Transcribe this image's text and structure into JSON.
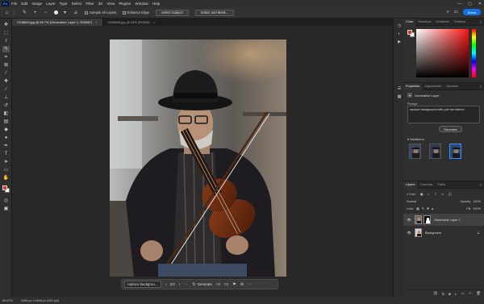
{
  "menu": [
    "File",
    "Edit",
    "Image",
    "Layer",
    "Type",
    "Select",
    "Filter",
    "3D",
    "View",
    "Plugins",
    "Window",
    "Help"
  ],
  "app_logo": "Ps",
  "window_controls": [
    "—",
    "▢",
    "✕"
  ],
  "options": {
    "sample_all_layers": "Sample All Layers",
    "enhance_edge": "Enhance Edge",
    "select_subject": "Select Subject",
    "select_and_mask": "Select and Mask...",
    "share": "Share"
  },
  "tabs": [
    {
      "label": "2108849.jpg @ 66.7% (Generative Layer 1, RGB/8*)",
      "active": true
    },
    {
      "label": "2108849.jpg @ 25% (RGB/8)",
      "active": false
    }
  ],
  "contextual_bar": {
    "prompt": "replace backgrou...",
    "pager": "2/3",
    "generate": "Generate"
  },
  "status": {
    "zoom": "66.67%",
    "info": "3456 px x 4608 px (240 ppi)"
  },
  "color_panel": {
    "tabs": [
      "Color",
      "Swatches",
      "Gradients",
      "Patterns"
    ]
  },
  "properties_panel": {
    "tabs": [
      "Properties",
      "Adjustments",
      "Libraries"
    ],
    "layer_type": "Generative Layer",
    "prompt_label": "Prompt",
    "prompt_text": "replace background with pub bar interior",
    "generate": "Generate",
    "variations_label": "Variations"
  },
  "layers_panel": {
    "tabs": [
      "Layers",
      "Channels",
      "Paths"
    ],
    "filter": "Kind",
    "mode": "Normal",
    "opacity_label": "Opacity:",
    "opacity": "100%",
    "lock_label": "Lock:",
    "fill_label": "Fill:",
    "fill": "100%",
    "layers": [
      {
        "name": "Generative Layer 1",
        "selected": true
      },
      {
        "name": "Background",
        "selected": false
      }
    ]
  },
  "colors": {
    "foreground": "#d6332e",
    "background": "#ffffff",
    "accent": "#1473e6"
  }
}
